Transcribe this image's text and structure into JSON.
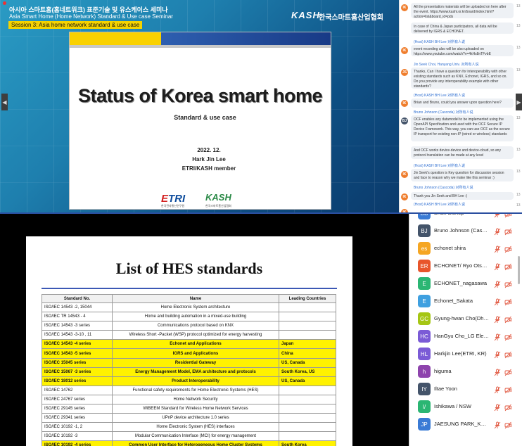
{
  "top_banner": {
    "korean_title": "아시아 스마트홈(홈네트워크) 표준기술 및 유스케이스 세미나",
    "english_title": "Asia Smart Home (Home Network) Standard & Use case Seminar",
    "session": "Session 3: Asia home network standard & use case",
    "kash_logo": "KASH",
    "kash_korean": "한국스마트홈산업협회"
  },
  "slide1": {
    "title": "Status of Korea smart home",
    "subtitle": "Standard & use case",
    "date": "2022. 12.",
    "author": "Hark Jin Lee",
    "org": "ETRI/KASH member",
    "logo_etri": "ETRI",
    "logo_etri_sub": "한국전자통신연구원",
    "logo_kash": "KASH",
    "logo_kash_sub": "한국스마트홈산업협회"
  },
  "chat": {
    "messages": [
      {
        "initials": "IK",
        "color": "#ef7d2c",
        "who": "",
        "text": "All the presentation materials will be uploaded on here after the event. https://www.kashi.or.kr/board/index.html?action=list&board_id=pds",
        "num": "13"
      },
      {
        "initials": "",
        "color": "",
        "who": "",
        "text": "In case of China & Japan participators, all data will be delivered by IGRS & ECHONET.",
        "num": "13"
      },
      {
        "initials": "IK",
        "color": "#ef7d2c",
        "who": "(Host) KASH BH Lee 对所有人说",
        "text": "event recording also will be also uploaded on https://www.youtube.com/watch?v=4kHs8nTFvbE",
        "num": "13"
      },
      {
        "initials": "JS",
        "color": "#ef7d2c",
        "who": "Jin Seek Choi, Hanyang Univ. 对所有人说",
        "text": "Thanks, Can I have a question for interoperability with other existing standards such as KNX, Echonet, IGRS, and so on. Do you provide any interoperability example with other standards?",
        "num": "13"
      },
      {
        "initials": "IK",
        "color": "#ef7d2c",
        "who": "(Host) KASH BH Lee 对所有人说",
        "text": "Brian and Bruno, could you answer upon question here?",
        "num": "13"
      },
      {
        "initials": "BJ",
        "color": "#44546a",
        "who": "Bruno Johnson (Cascoda) 对所有人说",
        "text": "OCF enables any datamodel to be implemented using the OpenAPI Specification and used with the OCF Secure IP Device Framework. This way, you can use OCF as the secure IP transport for existing non-IP (wired or wireless) standards",
        "num": "13"
      },
      {
        "initials": "",
        "color": "",
        "who": "",
        "text": "And OCF works device-device and device-cloud, so any protocol translation can be made at any level",
        "num": "13"
      },
      {
        "initials": "IK",
        "color": "#ef7d2c",
        "who": "(Host) KASH BH Lee 对所有人说",
        "text": "Jin Seek's question is Key question for discussion session and face to reason why we make like this seminar :)",
        "num": "13"
      },
      {
        "initials": "IK",
        "color": "#ef7d2c",
        "who": "Bruno Johnson (Cascoda) 对所有人说",
        "text": "Thank you Jin Seek and BH Lee :)",
        "num": "13"
      },
      {
        "initials": "IK",
        "color": "#ef7d2c",
        "who": "(Host) KASH BH Lee 对所有人说",
        "text": "",
        "num": "13"
      }
    ]
  },
  "slide2": {
    "title": "List of HES standards",
    "headers": [
      "Standard No.",
      "Name",
      "Leading Countries"
    ],
    "rows": [
      {
        "no": "ISO/IEC 14543 -2, 15044",
        "name": "Home Electronic System architecture",
        "country": "",
        "hl": false
      },
      {
        "no": "ISO/IEC TR 14543 - 4",
        "name": "Home and building automation in a mixed-use building",
        "country": "",
        "hl": false
      },
      {
        "no": "ISO/IEC 14543 -3 series",
        "name": "Communications protocol based on KNX",
        "country": "",
        "hl": false
      },
      {
        "no": "ISO/IEC 14543 -3-10 , 11",
        "name": "Wireless Short -Packet (WSP) protocol optimized for energy harvesting",
        "country": "",
        "hl": false
      },
      {
        "no": "ISO/IEC 14543 -4 series",
        "name": "Echonet and Applications",
        "country": "Japan",
        "hl": true
      },
      {
        "no": "ISO/IEC 14543 -5 series",
        "name": "IGRS and Applications",
        "country": "China",
        "hl": true
      },
      {
        "no": "ISO/IEC 15045 series",
        "name": "Residential Gateway",
        "country": "US, Canada",
        "hl": true
      },
      {
        "no": "ISO/IEC 15067 -3 series",
        "name": "Energy Management Model, EMA architecture and protocols",
        "country": "South Korea, US",
        "hl": true
      },
      {
        "no": "ISO/IEC 18012 series",
        "name": "Product Interoperability",
        "country": "US, Canada",
        "hl": true
      },
      {
        "no": "ISO/IEC 14762",
        "name": "Functional safety requirements for Home Electronic Systems (HES)",
        "country": "",
        "hl": false
      },
      {
        "no": "ISO/IEC 24767 series",
        "name": "Home Network Security",
        "country": "",
        "hl": false
      },
      {
        "no": "ISO/IEC 29145 series",
        "name": "WiBEEM Standard for Wireless Home Network Services",
        "country": "",
        "hl": false
      },
      {
        "no": "ISO/IEC 29341 series",
        "name": "UPnP device architecture 1.0 series",
        "country": "",
        "hl": false
      },
      {
        "no": "ISO/IEC 10192 -1, 2",
        "name": "Home Electronic System (HES) interfaces",
        "country": "",
        "hl": false
      },
      {
        "no": "ISO/IEC 10192 -3",
        "name": "Modular Communication Interface (MCI) for energy management",
        "country": "",
        "hl": false
      },
      {
        "no": "ISO/IEC 10192 -4 series",
        "name": "Common User Interface for Heterogeneous Home Cluster Systems",
        "country": "South Korea",
        "hl": true
      }
    ]
  },
  "participants": [
    {
      "initials": "BB",
      "color": "#3a7bd5",
      "name": "Brian Bishop"
    },
    {
      "initials": "BJ",
      "color": "#44546a",
      "name": "Bruno Johnson (Casco..."
    },
    {
      "initials": "es",
      "color": "#f5a623",
      "name": "echonet shira"
    },
    {
      "initials": "ER",
      "color": "#e8552b",
      "name": "ECHONET/ Ryo Otsuka"
    },
    {
      "initials": "E",
      "color": "#2bb673",
      "name": "ECHONET_nagasawa"
    },
    {
      "initials": "E",
      "color": "#3fa0e0",
      "name": "Echonet_Sakata"
    },
    {
      "initials": "GC",
      "color": "#a5c614",
      "name": "Gyung-hwan Cho(Dhs..."
    },
    {
      "initials": "HC",
      "color": "#7b5bd6",
      "name": "HanGyu Cho_LG Electr..."
    },
    {
      "initials": "HL",
      "color": "#7b5bd6",
      "name": "Harkjin Lee(ETRI, KR)"
    },
    {
      "initials": "h",
      "color": "#8e44ad",
      "name": "higuma"
    },
    {
      "initials": "IY",
      "color": "#44546a",
      "name": "Iltae Yoon"
    },
    {
      "initials": "I/",
      "color": "#2bb673",
      "name": "Ishikawa / NSW"
    },
    {
      "initials": "JP",
      "color": "#3a7bd5",
      "name": "JAESUNG PARK_KASH"
    }
  ],
  "icons": {
    "mic_muted": "mic-muted-icon",
    "cam_off": "camera-off-icon",
    "nav_prev": "chevron-left-icon",
    "nav_next": "chevron-right-icon"
  }
}
